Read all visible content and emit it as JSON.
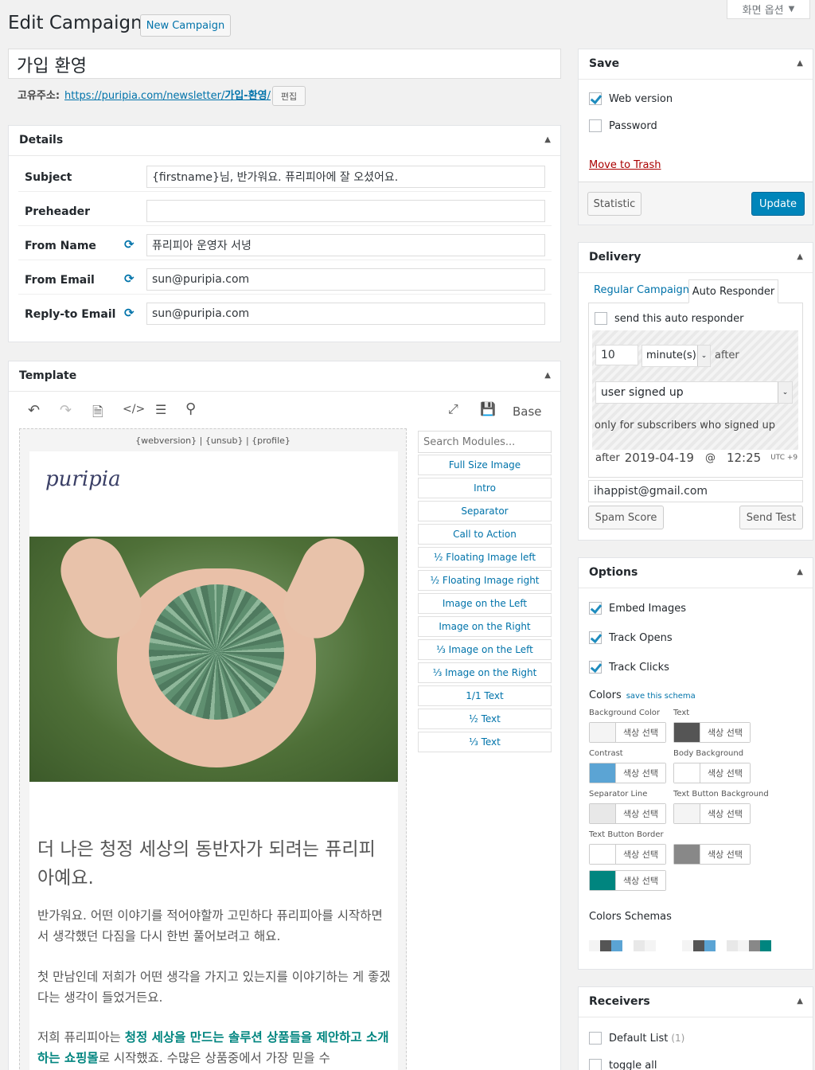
{
  "screen_options": "화면 옵션",
  "header": {
    "title": "Edit Campaign",
    "new_button": "New Campaign"
  },
  "campaign_title": "가입 환영",
  "permalink": {
    "label": "고유주소:",
    "url_prefix": "https://puripia.com/newsletter/",
    "url_slug": "가입-환영",
    "url_suffix": "/",
    "edit": "편집"
  },
  "details": {
    "heading": "Details",
    "fields": [
      {
        "label": "Subject",
        "value": "{firstname}님, 반가워요. 퓨리피아에 잘 오셨어요.",
        "sync": false
      },
      {
        "label": "Preheader",
        "value": "",
        "sync": false
      },
      {
        "label": "From Name",
        "value": "퓨리피아 운영자 서녕",
        "sync": true
      },
      {
        "label": "From Email",
        "value": "sun@puripia.com",
        "sync": true
      },
      {
        "label": "Reply-to Email",
        "value": "sun@puripia.com",
        "sync": true
      }
    ]
  },
  "template": {
    "heading": "Template",
    "base_label": "Base",
    "preview_header": "{webversion} | {unsub} | {profile}",
    "logo": "puripia",
    "headline": "더 나은 청정 세상의 동반자가 되려는 퓨리피아예요.",
    "para1": "반가워요. 어떤 이야기를 적어야할까 고민하다 퓨리피아를 시작하면서 생각했던 다짐을 다시 한번 풀어보려고 해요.",
    "para2": "첫 만남인데 저희가 어떤 생각을 가지고 있는지를 이야기하는 게 좋겠다는 생각이 들었거든요.",
    "para3_prefix": "저희 퓨리피아는 ",
    "para3_bold": "청정 세상을 만드는 솔루션 상품들을 제안하고 소개하는 쇼핑몰",
    "para3_suffix": "로 시작했죠. 수많은 상품중에서 가장 믿을 수",
    "search_placeholder": "Search Modules...",
    "modules": [
      "Full Size Image",
      "Intro",
      "Separator",
      "Call to Action",
      "½ Floating Image left",
      "½ Floating Image right",
      "Image on the Left",
      "Image on the Right",
      "⅓ Image on the Left",
      "⅓ Image on the Right",
      "1/1 Text",
      "½ Text",
      "⅓ Text"
    ]
  },
  "save": {
    "heading": "Save",
    "web_version": "Web version",
    "password": "Password",
    "trash": "Move to Trash",
    "statistic": "Statistic",
    "update": "Update"
  },
  "delivery": {
    "heading": "Delivery",
    "tab_regular": "Regular Campaign",
    "tab_auto": "Auto Responder",
    "send_auto": "send this auto responder",
    "amount": "10",
    "unit": "minute(s)",
    "after": "after",
    "trigger": "user signed up",
    "only_for": "only for subscribers who signed up",
    "after2": "after",
    "date": "2019-04-19",
    "at": "@",
    "time": "12:25",
    "tz": "UTC +9",
    "test_email": "ihappist@gmail.com",
    "spam_score": "Spam Score",
    "send_test": "Send Test"
  },
  "options": {
    "heading": "Options",
    "embed_images": "Embed Images",
    "track_opens": "Track Opens",
    "track_clicks": "Track Clicks",
    "colors_label": "Colors",
    "save_schema": "save this schema",
    "color_fields": [
      {
        "label": "Background Color",
        "color": "#f4f4f4",
        "button": "색상 선택"
      },
      {
        "label": "Text",
        "color": "#555555",
        "button": "색상 선택"
      },
      {
        "label": "Contrast",
        "color": "#5ba4d4",
        "button": "색상 선택"
      },
      {
        "label": "Body Background",
        "color": "#ffffff",
        "button": "색상 선택"
      },
      {
        "label": "Separator Line",
        "color": "#e8e8e8",
        "button": "색상 선택"
      },
      {
        "label": "Text Button Background",
        "color": "#f4f4f4",
        "button": "색상 선택"
      },
      {
        "label": "Text Button Border",
        "color": "#ffffff",
        "button": "색상 선택"
      },
      {
        "label": "",
        "color": "#888888",
        "button": "색상 선택"
      },
      {
        "label": "",
        "color": "#00857f",
        "button": "색상 선택"
      }
    ],
    "schemas_label": "Colors Schemas",
    "schema1": [
      "#f4f4f4",
      "#555555",
      "#5ba4d4",
      "#ffffff",
      "#e8e8e8",
      "#f4f4f4",
      "#ffffff"
    ],
    "schema2": [
      "#f4f4f4",
      "#555555",
      "#5ba4d4",
      "#ffffff",
      "#e8e8e8",
      "#f4f4f4",
      "#888888",
      "#00857f"
    ]
  },
  "receivers": {
    "heading": "Receivers",
    "default_list": "Default List",
    "default_count": "(1)",
    "toggle_all": "toggle all"
  }
}
